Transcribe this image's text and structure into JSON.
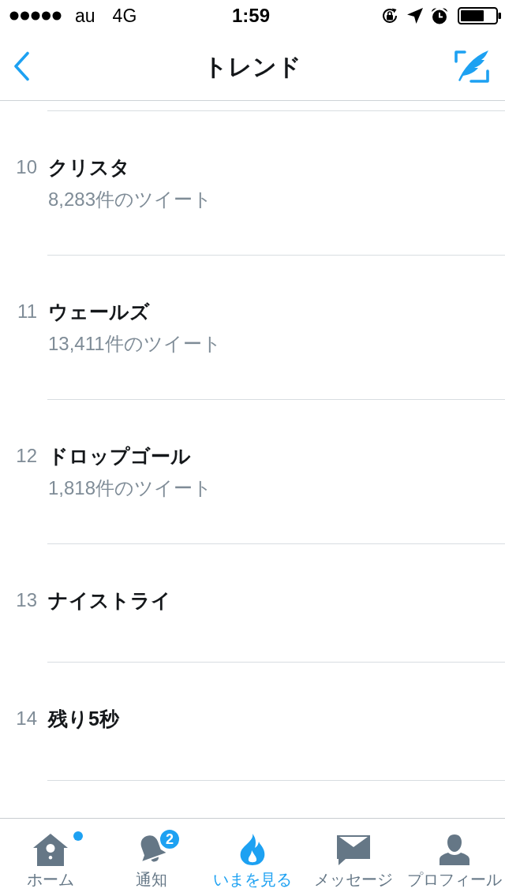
{
  "status_bar": {
    "carrier": "au",
    "network": "4G",
    "time": "1:59"
  },
  "nav_bar": {
    "title": "トレンド"
  },
  "trends": [
    {
      "rank": "10",
      "name": "クリスタ",
      "tweet_count": "8,283件のツイート"
    },
    {
      "rank": "11",
      "name": "ウェールズ",
      "tweet_count": "13,411件のツイート"
    },
    {
      "rank": "12",
      "name": "ドロップゴール",
      "tweet_count": "1,818件のツイート"
    },
    {
      "rank": "13",
      "name": "ナイストライ"
    },
    {
      "rank": "14",
      "name": "残り5秒"
    }
  ],
  "tab_bar": [
    {
      "kind": "home",
      "label": "ホーム",
      "selected": false,
      "new_dot": true
    },
    {
      "kind": "notifications",
      "label": "通知",
      "selected": false,
      "new_dot": false,
      "badge": "2"
    },
    {
      "kind": "moments",
      "label": "いまを見る",
      "selected": true,
      "new_dot": false
    },
    {
      "kind": "messages",
      "label": "メッセージ",
      "selected": false,
      "new_dot": false
    },
    {
      "kind": "profile",
      "label": "プロフィール",
      "selected": false,
      "new_dot": false
    }
  ]
}
